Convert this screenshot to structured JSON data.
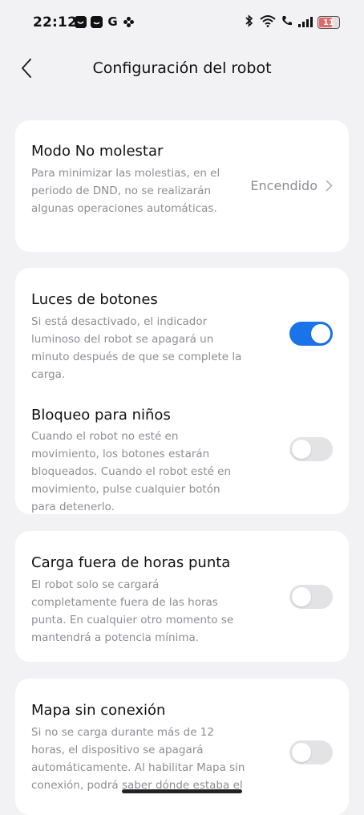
{
  "status_bar": {
    "time": "22:12",
    "left_icons": [
      "app-icon-1",
      "app-icon-2",
      "google-g-icon",
      "flower-icon"
    ],
    "g_letter": "G",
    "right_icons": [
      "bluetooth-icon",
      "wifi-icon",
      "call-icon",
      "signal-icon"
    ],
    "battery_level": "11",
    "battery_color": "#e06a6a"
  },
  "header": {
    "title": "Configuración del robot"
  },
  "settings": {
    "dnd": {
      "title": "Modo No molestar",
      "description": "Para minimizar las molestias, en el periodo de DND, no se realizarán algunas operaciones automáticas.",
      "value": "Encendido"
    },
    "button_lights": {
      "title": "Luces de botones",
      "description": "Si está desactivado, el indicador luminoso del robot se apagará un minuto después de que se complete la carga.",
      "enabled": true
    },
    "child_lock": {
      "title": "Bloqueo para niños",
      "description": "Cuando el robot no esté en movimiento, los botones estarán bloqueados. Cuando el robot esté en movimiento, pulse cualquier botón para detenerlo.",
      "enabled": false
    },
    "offpeak_charging": {
      "title": "Carga fuera de horas punta",
      "description": "El robot solo se cargará completamente fuera de las horas punta. En cualquier otro momento se mantendrá a potencia mínima.",
      "enabled": false
    },
    "offline_map": {
      "title": "Mapa sin conexión",
      "description": "Si no se carga durante más de 12 horas, el dispositivo se apagará automáticamente. Al habilitar Mapa sin conexión, podrá saber dónde estaba el",
      "enabled": false
    }
  },
  "colors": {
    "accent": "#1a73e8",
    "background": "#f2f2f4",
    "card": "#ffffff",
    "secondary_text": "#8e8e93"
  }
}
